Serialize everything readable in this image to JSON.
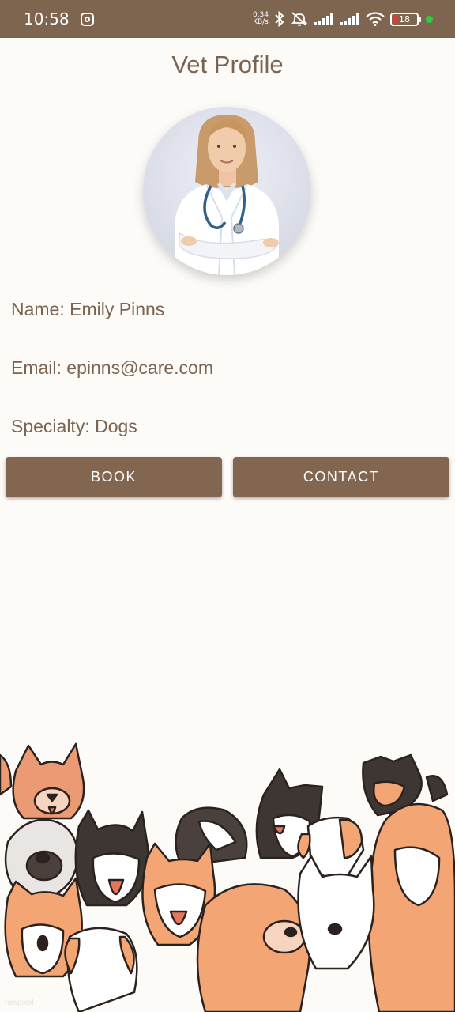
{
  "status_bar": {
    "time": "10:58",
    "net_speed_value": "0.34",
    "net_speed_unit": "KB/s",
    "battery_level": "18",
    "icons": [
      "instagram-icon",
      "bluetooth-icon",
      "mute-icon",
      "signal-icon",
      "signal-icon",
      "wifi-icon",
      "battery-icon"
    ]
  },
  "page": {
    "title": "Vet Profile"
  },
  "profile": {
    "name": "Name: Emily Pinns",
    "email": "Email: epinns@care.com",
    "specialty": "Specialty: Dogs"
  },
  "actions": {
    "book_label": "BOOK",
    "contact_label": "CONTACT"
  },
  "footer": {
    "watermark": "rawpixel"
  },
  "colors": {
    "primary": "#826650",
    "status_bar": "#7d6550",
    "background": "#fdfbf8",
    "text": "#7a6350"
  }
}
